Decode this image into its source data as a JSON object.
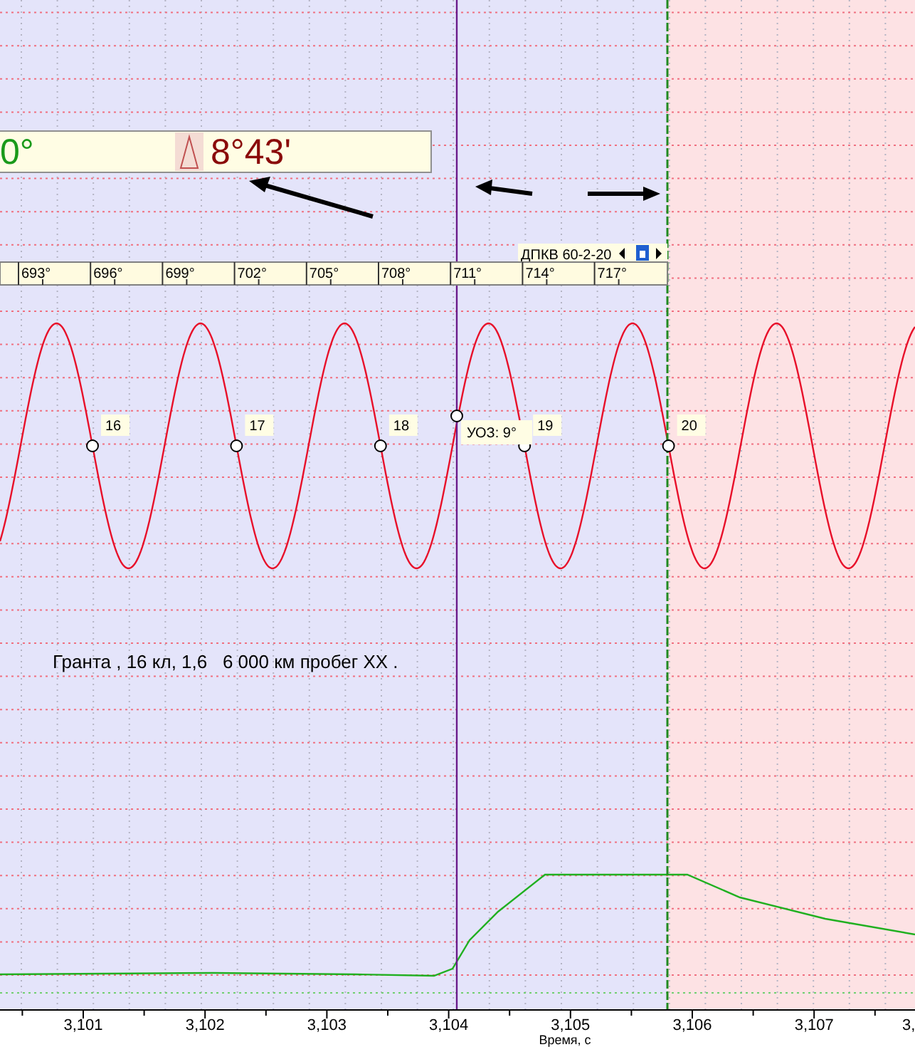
{
  "info_panel": {
    "angle": "0°",
    "delta": "8°43'"
  },
  "sensor_label": "ДПКВ 60-2-20",
  "angle_scale": [
    "693°",
    "696°",
    "699°",
    "702°",
    "705°",
    "708°",
    "711°",
    "714°",
    "717°"
  ],
  "markers": [
    {
      "label": "16"
    },
    {
      "label": "17"
    },
    {
      "label": "18"
    },
    {
      "label": "19"
    },
    {
      "label": "20"
    }
  ],
  "cursor_label": "УОЗ: 9°",
  "note": "Гранта , 16 кл, 1,6   6 000 км пробег XX .",
  "time_axis": {
    "ticks": [
      "3,101",
      "3,102",
      "3,103",
      "3,104",
      "3,105",
      "3,106",
      "3,107",
      "3,"
    ],
    "label": "Время, с"
  }
}
